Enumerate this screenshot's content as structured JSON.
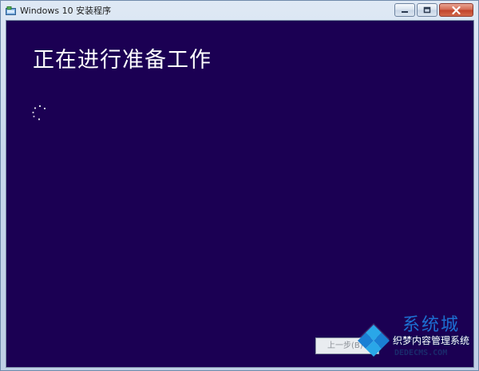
{
  "window": {
    "title": "Windows 10 安装程序",
    "icon": "setup-icon",
    "caption_buttons": [
      "minimize-icon",
      "maximize-icon",
      "close-icon"
    ],
    "content_bg": "#1b0053"
  },
  "main": {
    "heading": "正在进行准备工作",
    "spinner": "loading-spinner-icon"
  },
  "footer": {
    "back_label": "上一步(B)"
  },
  "watermark": {
    "brand": "系统城",
    "tagline": "织梦内容管理系统",
    "site": "DEDECMS.COM"
  }
}
